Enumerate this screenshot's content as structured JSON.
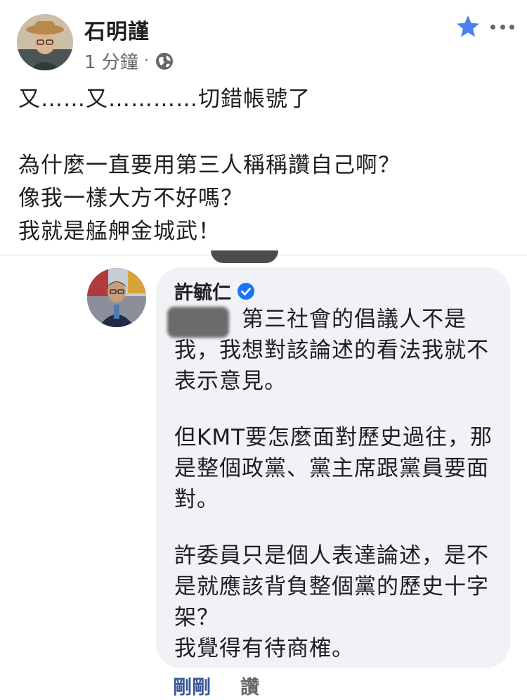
{
  "post": {
    "author": "石明謹",
    "time": "1 分鐘",
    "meta_dot": "·",
    "privacy_icon": "globe-icon",
    "lines": [
      "又……又…………切錯帳號了",
      "",
      "為什麼一直要用第三人稱稱讚自己啊？",
      "像我一樣大方不好嗎？",
      "我就是艋舺金城武！"
    ]
  },
  "comment": {
    "author": "許毓仁",
    "verified": true,
    "text_lines": [
      "　　　第三社會的倡議人不是",
      "我，我想對該論述的看法我就不",
      "表示意見。",
      "",
      "但KMT要怎麼面對歷史過往，那",
      "是整個政黨、黨主席跟黨員要面",
      "對。",
      "",
      "許委員只是個人表達論述，是不",
      "是就應該背負整個黨的歷史十字",
      "架？",
      "我覺得有待商榷。"
    ],
    "time_label": "剛剛",
    "like_label": "讚"
  },
  "colors": {
    "accent_blue": "#4a80f0",
    "verified_blue": "#1877f2",
    "bubble_bg": "#f0f2f5",
    "meta_gray": "#65676b"
  }
}
